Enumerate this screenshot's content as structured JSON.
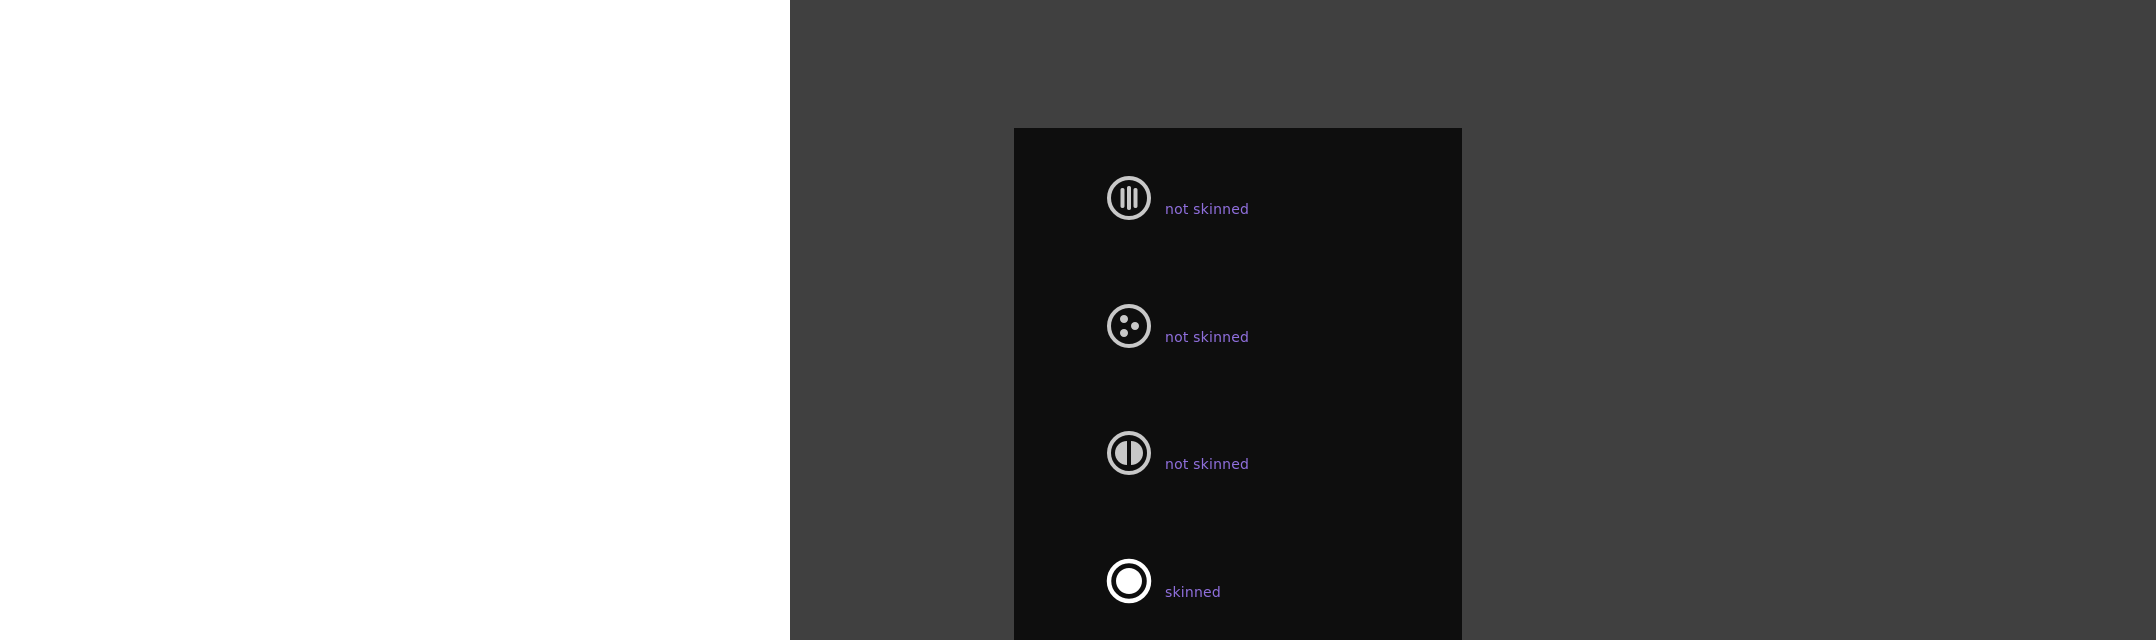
{
  "colors": {
    "left_background": "#ffffff",
    "stage_background": "#404040",
    "panel_background": "#0e0e0e",
    "label_color": "#8f6fdc",
    "icon_gray": "#c8c8c8",
    "icon_white": "#ffffff"
  },
  "items": [
    {
      "icon": "pause-bars-icon",
      "label": "not skinned"
    },
    {
      "icon": "dots-icon",
      "label": "not skinned"
    },
    {
      "icon": "half-circle-icon",
      "label": "not skinned"
    },
    {
      "icon": "record-icon",
      "label": "skinned"
    }
  ]
}
